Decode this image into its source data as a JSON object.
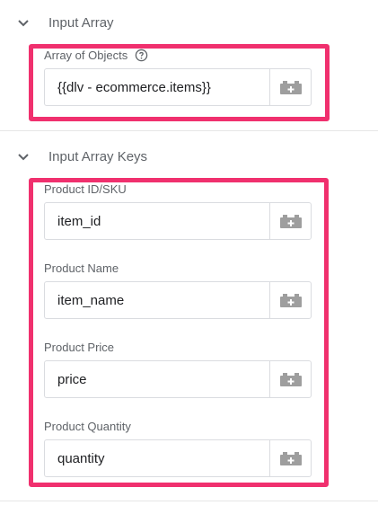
{
  "sections": [
    {
      "title": "Input Array",
      "fields": [
        {
          "label": "Array of Objects",
          "value": "{{dlv - ecommerce.items}}",
          "has_help": true
        }
      ]
    },
    {
      "title": "Input Array Keys",
      "fields": [
        {
          "label": "Product ID/SKU",
          "value": "item_id"
        },
        {
          "label": "Product Name",
          "value": "item_name"
        },
        {
          "label": "Product Price",
          "value": "price"
        },
        {
          "label": "Product Quantity",
          "value": "quantity"
        }
      ]
    }
  ],
  "icons": {
    "section_toggle": "chevron-down-icon",
    "help": "help-circle-icon",
    "variable_picker": "add-variable-icon"
  },
  "colors": {
    "highlight": "#f0306e",
    "icon": "#9e9e9e"
  }
}
